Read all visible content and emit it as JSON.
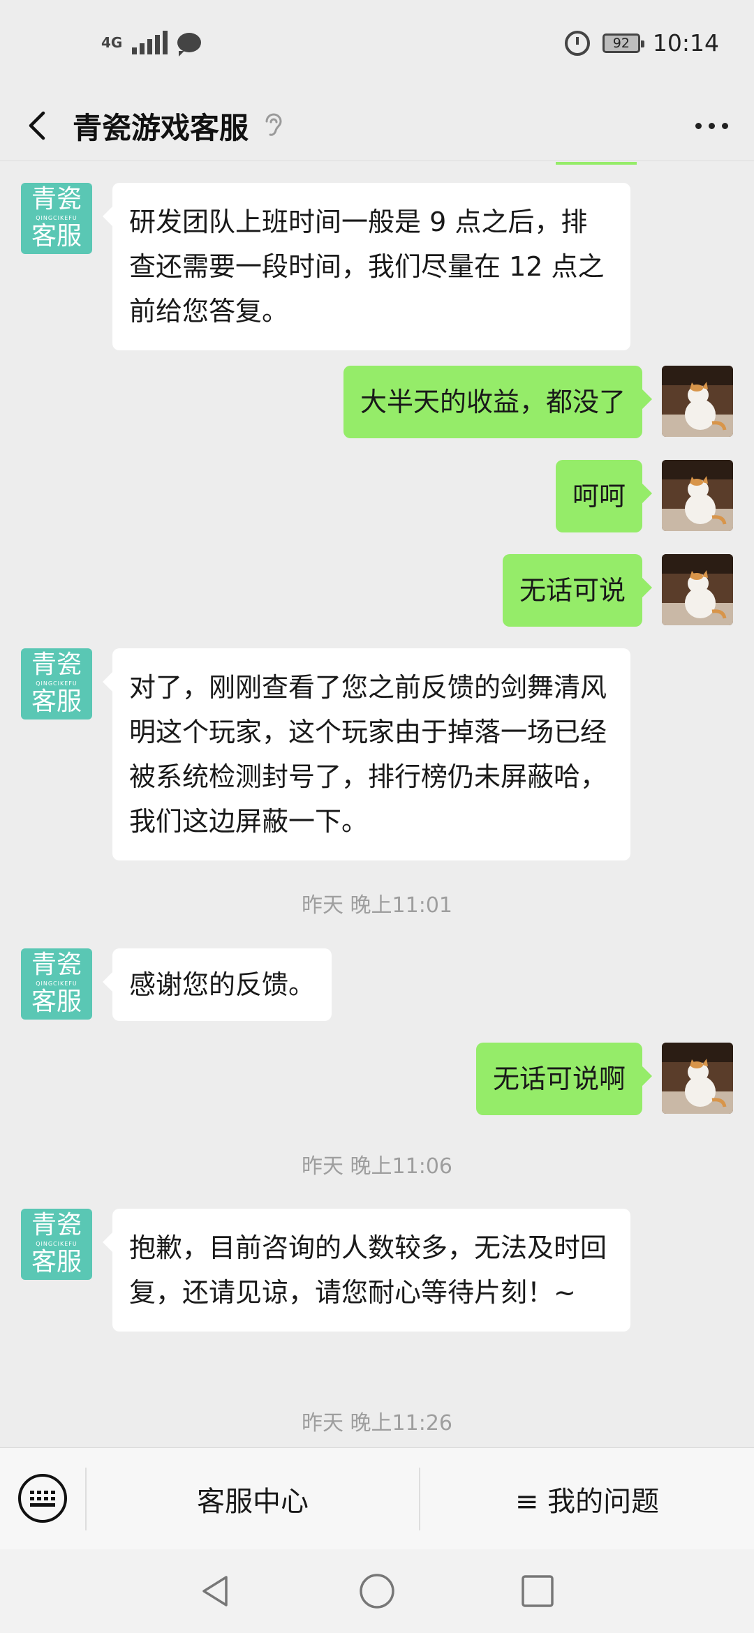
{
  "status_bar": {
    "network": "4G",
    "battery": "92",
    "time": "10:14"
  },
  "header": {
    "title": "青瓷游戏客服"
  },
  "service_avatar": {
    "line1": "青瓷",
    "line2": "客服",
    "pinyin": "QINGCIKEFU"
  },
  "messages": [
    {
      "from": "service",
      "text": "研发团队上班时间一般是 9 点之后，排查还需要一段时间，我们尽量在 12 点之前给您答复。"
    },
    {
      "from": "user",
      "text": "大半天的收益，都没了"
    },
    {
      "from": "user",
      "text": "呵呵"
    },
    {
      "from": "user",
      "text": "无话可说"
    },
    {
      "from": "service",
      "text": "对了，刚刚查看了您之前反馈的剑舞清风明这个玩家，这个玩家由于掉落一场已经被系统检测封号了，排行榜仍未屏蔽哈，我们这边屏蔽一下。"
    },
    {
      "from": "time",
      "text": "昨天 晚上11:01"
    },
    {
      "from": "service",
      "text": "感谢您的反馈。"
    },
    {
      "from": "user",
      "text": "无话可说啊"
    },
    {
      "from": "time",
      "text": "昨天 晚上11:06"
    },
    {
      "from": "service",
      "text": "抱歉，目前咨询的人数较多，无法及时回复，还请见谅，请您耐心等待片刻！~"
    },
    {
      "from": "time",
      "text": "昨天 晚上11:26"
    }
  ],
  "bottom_menu": {
    "item1": "客服中心",
    "item2": "≡ 我的问题"
  },
  "colors": {
    "outgoing_bubble": "#95ec69",
    "incoming_bubble": "#ffffff",
    "service_avatar": "#5ac7b4",
    "background": "#ededed"
  },
  "icons": [
    "back-arrow-icon",
    "ear-icon",
    "more-dots-icon",
    "keyboard-icon",
    "nav-back-icon",
    "nav-home-icon",
    "nav-recent-icon",
    "alarm-icon",
    "battery-icon",
    "signal-icon",
    "message-icon"
  ]
}
